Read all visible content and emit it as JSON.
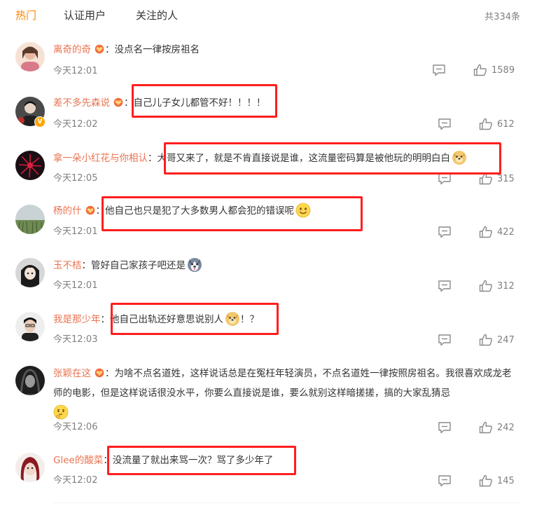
{
  "tabs": [
    {
      "label": "热门",
      "active": true
    },
    {
      "label": "认证用户",
      "active": false
    },
    {
      "label": "关注的人",
      "active": false
    }
  ],
  "total": "共334条",
  "colors": {
    "accent": "#ff8200",
    "username": "#eb7350",
    "highlight": "#ff1e1e"
  },
  "comments": [
    {
      "user": "离奇的奇",
      "sep": "：",
      "text": "没点名一律按房祖名",
      "time": "今天12:01",
      "likes": "1589",
      "highlighted": false
    },
    {
      "user": "差不多先森说",
      "sep": "：",
      "text": "自己儿子女儿都管不好！！！！",
      "time": "今天12:02",
      "likes": "612",
      "highlighted": true,
      "verified": true
    },
    {
      "user": "拿一朵小红花与你相认",
      "sep": "：",
      "text": "大哥又来了，就是不肯直接说是谁，这流量密码算是被他玩的明明白白",
      "emoji": "doge-emoji",
      "time": "今天12:05",
      "likes": "315",
      "highlighted": true
    },
    {
      "user": "杨的什",
      "sep": "：",
      "text": "他自己也只是犯了大多数男人都会犯的错误呢",
      "emoji": "smile-emoji",
      "time": "今天12:01",
      "likes": "422",
      "highlighted": true
    },
    {
      "user": "玉不桔",
      "sep": "：",
      "text": "管好自己家孩子吧还是",
      "emoji": "husky-emoji",
      "time": "今天12:01",
      "likes": "312",
      "highlighted": false
    },
    {
      "user": "我是那少年",
      "sep": "：",
      "text": "他自己出轨还好意思说别人",
      "emoji": "doge-emoji",
      "text_after": "！？",
      "time": "今天12:03",
      "likes": "247",
      "highlighted": true
    },
    {
      "user": "张颖在这",
      "sep": "：",
      "text": "为啥不点名道姓，这样说话总是在冤枉年轻演员，不点名道姓一律按照房祖名。我很喜欢成龙老师的电影，但是这样说话很没水平，你要么直接说是谁，要么就别这样暗搓搓，搞的大家乱猜忌",
      "emoji": "thinking-emoji",
      "time": "今天12:06",
      "likes": "242",
      "highlighted": false
    },
    {
      "user": "Glee的酸菜",
      "sep": "：",
      "text": "没流量了就出来骂一次？骂了多少年了",
      "time": "今天12:02",
      "likes": "145",
      "highlighted": true
    }
  ]
}
